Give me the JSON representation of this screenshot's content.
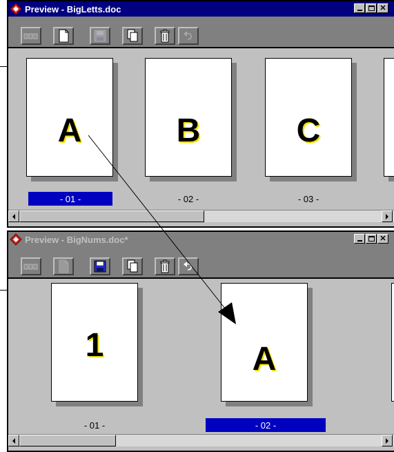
{
  "windows": [
    {
      "title": "Preview - BigLetts.doc",
      "pages": [
        {
          "letter": "A",
          "label": "- 01 -",
          "selected": true
        },
        {
          "letter": "B",
          "label": "- 02 -",
          "selected": false
        },
        {
          "letter": "C",
          "label": "- 03 -",
          "selected": false
        }
      ]
    },
    {
      "title": "Preview - BigNums.doc*",
      "pages": [
        {
          "letter": "1",
          "label": "- 01 -",
          "selected": false
        },
        {
          "letter": "A",
          "label": "- 02 -",
          "selected": true
        }
      ]
    }
  ],
  "toolbar_buttons": [
    "multi-page-view-icon",
    "single-page-icon",
    "save-icon",
    "copy-page-icon",
    "delete-icon",
    "undo-icon"
  ],
  "colors": {
    "title_active": "#000080",
    "title_inactive": "#808080",
    "selection": "#0000c0",
    "letter_outline": "#f0e000"
  }
}
